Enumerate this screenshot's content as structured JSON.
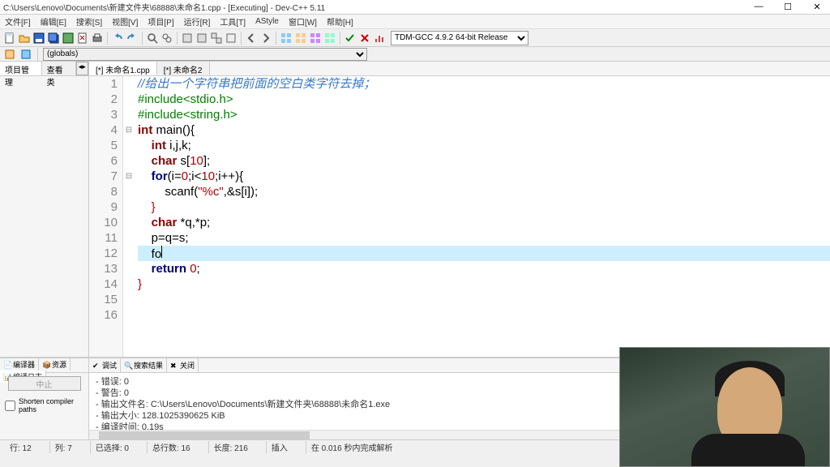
{
  "titlebar": {
    "text": "C:\\Users\\Lenovo\\Documents\\新建文件夹\\68888\\未命名1.cpp - [Executing] - Dev-C++ 5.11"
  },
  "menubar": [
    "文件[F]",
    "编辑[E]",
    "搜索[S]",
    "视图[V]",
    "项目[P]",
    "运行[R]",
    "工具[T]",
    "AStyle",
    "窗口[W]",
    "帮助[H]"
  ],
  "compiler_select": "TDM-GCC 4.9.2 64-bit Release",
  "globals_select": "(globals)",
  "sidebar_tabs": [
    "项目管理",
    "查看类"
  ],
  "editor_tabs": [
    "[*] 未命名1.cpp",
    "[*] 未命名2"
  ],
  "gutter": [
    "1",
    "2",
    "3",
    "4",
    "5",
    "6",
    "7",
    "8",
    "9",
    "10",
    "11",
    "12",
    "13",
    "14",
    "15",
    "16"
  ],
  "fold_marks": {
    "3": "⊟",
    "6": "⊟"
  },
  "code": {
    "l1_comment": "//给出一个字符串把前面的空白类字符去掉；",
    "l2": "#include<stdio.h>",
    "l3": "#include<string.h>",
    "l4_int": "int",
    "l4_main": " main(){",
    "l5_int": "int",
    "l5_rest": " i,j,k;",
    "l6_char": "char",
    "l6_rest": " s[",
    "l6_num": "10",
    "l6_end": "];",
    "l7_for": "for",
    "l7_rest": "(i=",
    "l7_n0": "0",
    "l7_mid": ";i<",
    "l7_n10": "10",
    "l7_end": ";i++){",
    "l8_scanf": "scanf(",
    "l8_str": "\"%c\"",
    "l8_rest": ",&s[i]);",
    "l9": "}",
    "l10_char": "char",
    "l10_rest": " *q,*p;",
    "l11": "p=q=s;",
    "l12": "fo",
    "l13_return": "return",
    "l13_sp": " ",
    "l13_num": "0",
    "l13_end": ";",
    "l14": "}"
  },
  "bottom_left_tabs": [
    "编译器",
    "资源",
    "编译日志"
  ],
  "bottom_right_tabs": [
    "调试",
    "搜索结果",
    "关闭"
  ],
  "bp_button": "中止",
  "bp_checkbox": "Shorten compiler paths",
  "output": [
    "错误: 0",
    "警告: 0",
    "输出文件名: C:\\Users\\Lenovo\\Documents\\新建文件夹\\68888\\未命名1.exe",
    "输出大小: 128.1025390625 KiB",
    "编译时间: 0.19s"
  ],
  "statusbar": {
    "line": "行: 12",
    "col": "列: 7",
    "sel": "已选择: 0",
    "total": "总行数: 16",
    "len": "长度: 216",
    "mode": "插入",
    "msg": "在 0.016 秒内完成解析"
  }
}
